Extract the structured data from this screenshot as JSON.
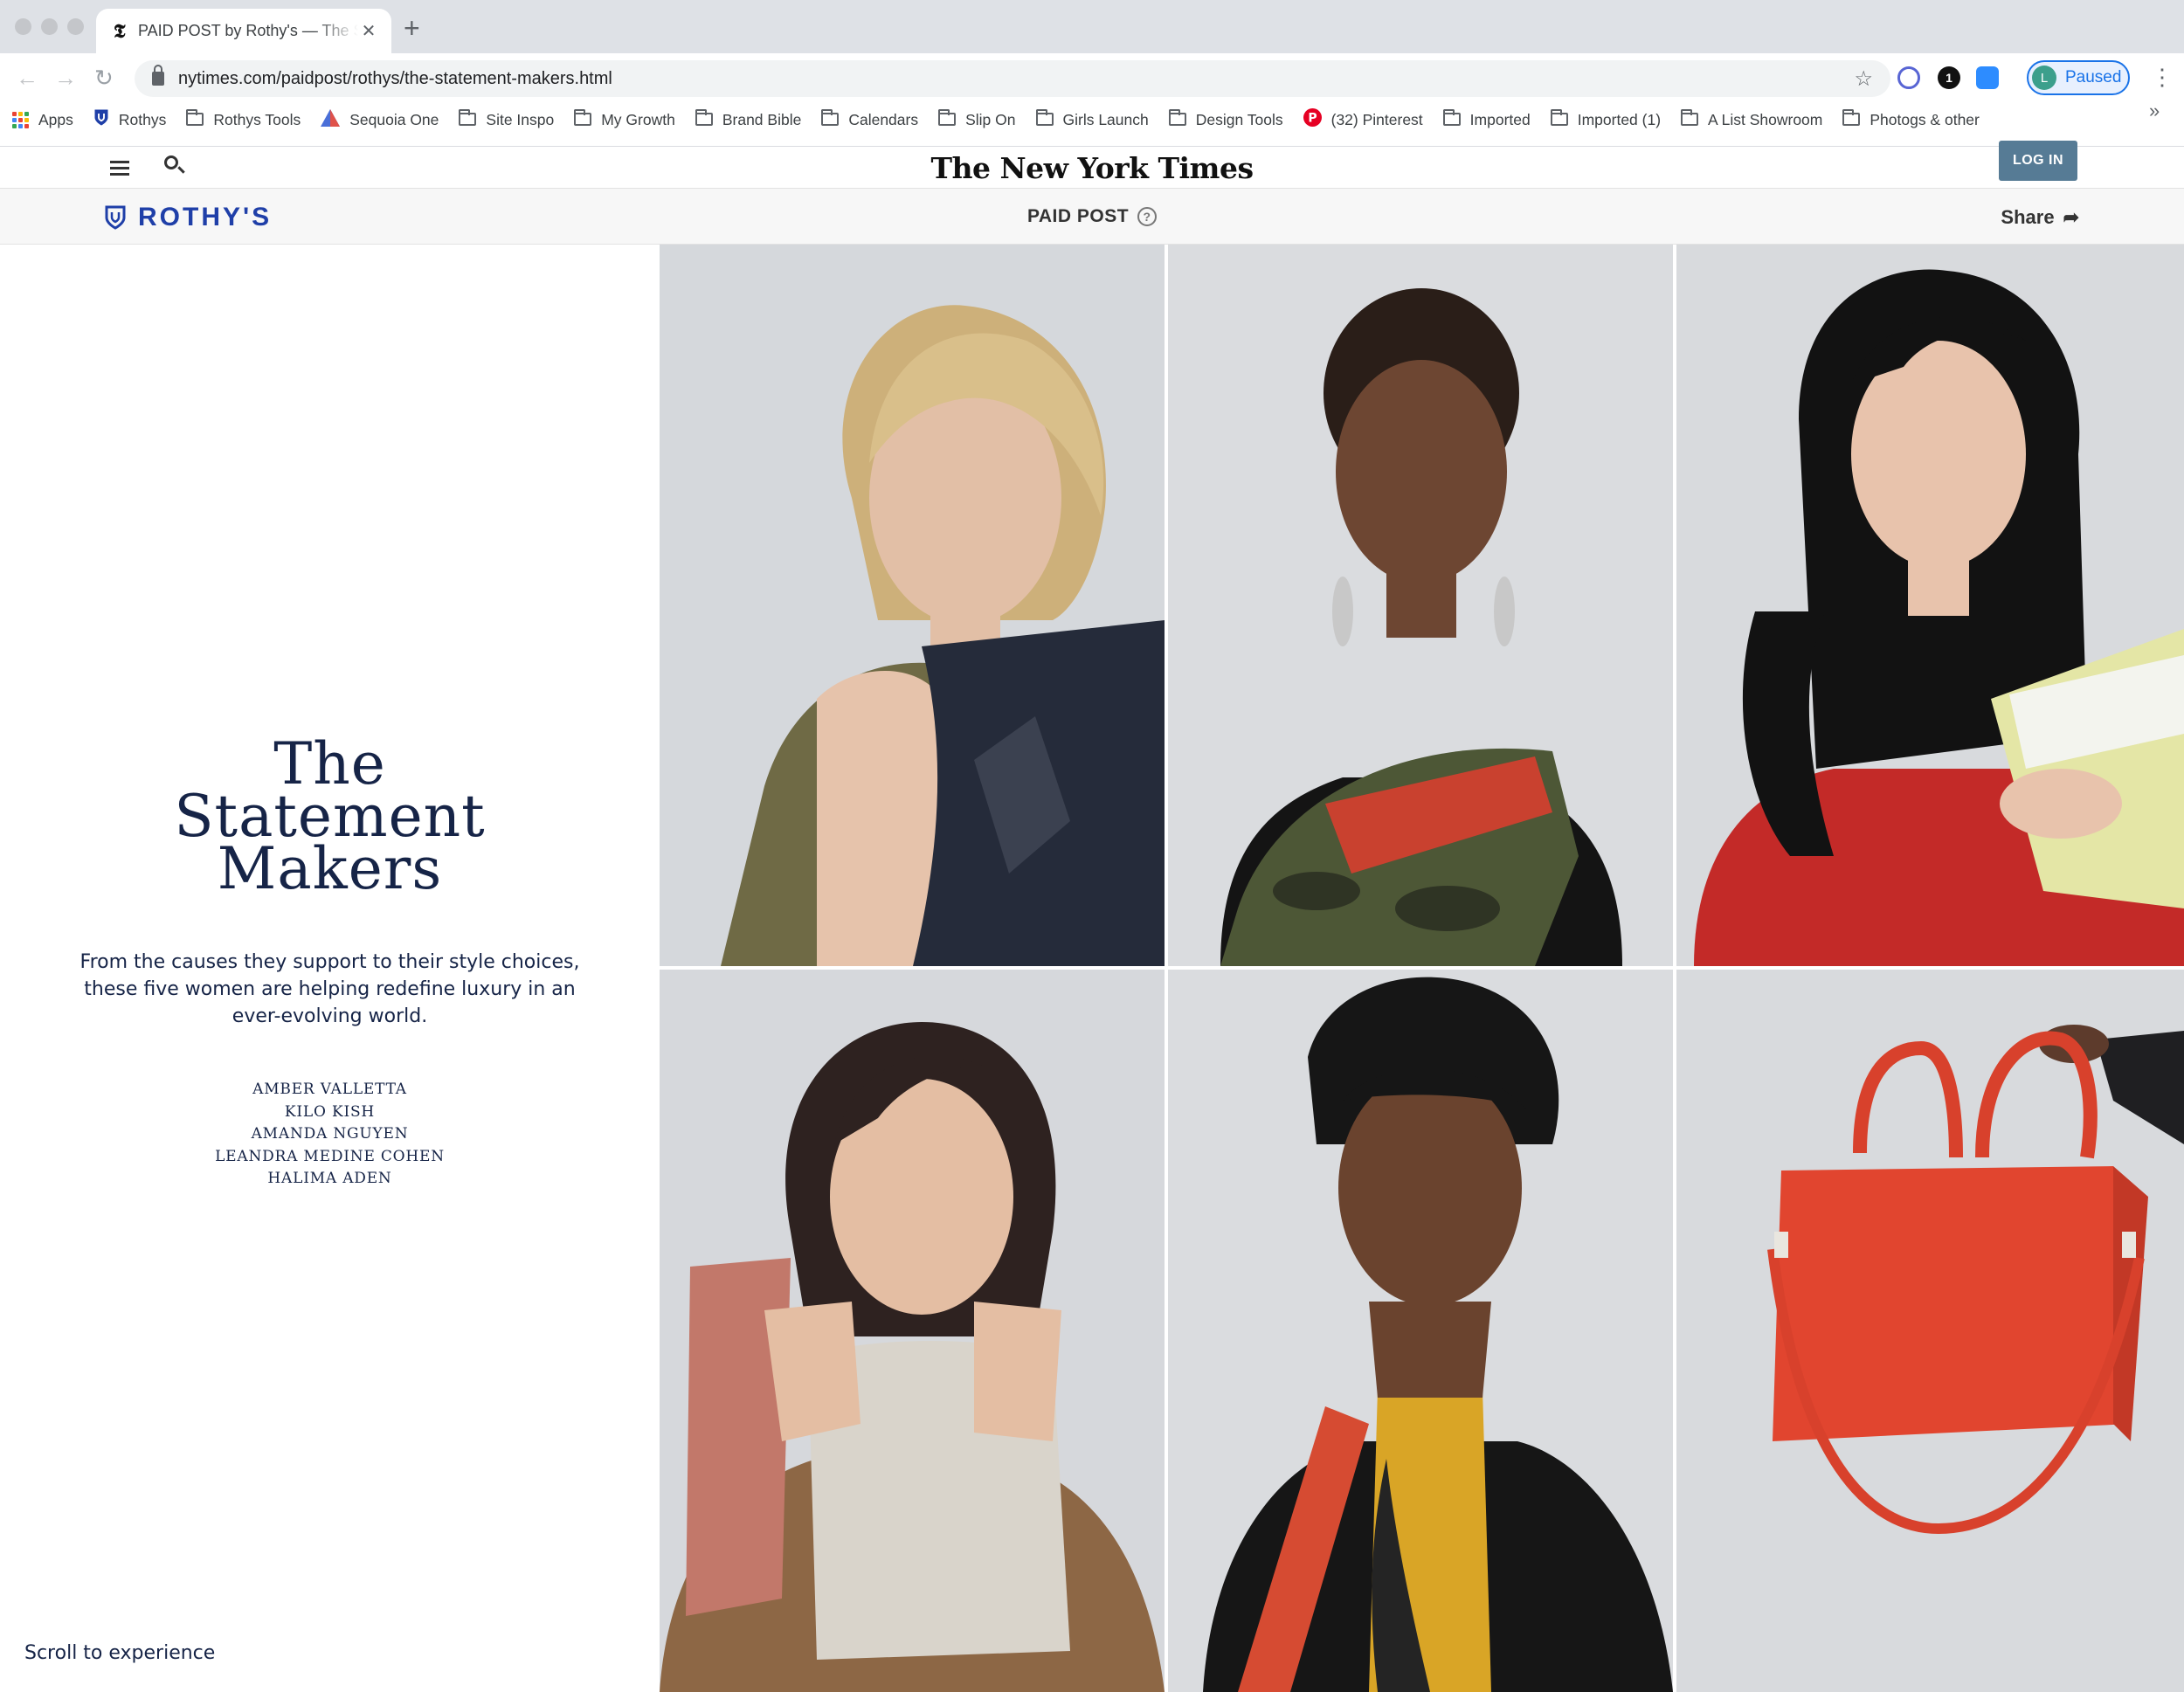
{
  "browser": {
    "tab_title": "PAID POST by Rothy's — The Statement Makers",
    "tab_favicon": "nyt-t-icon",
    "url": "nytimes.com/paidpost/rothys/the-statement-makers.html",
    "profile_initial": "L",
    "profile_status": "Paused",
    "bookmarks": [
      {
        "label": "Apps",
        "icon": "apps-grid-icon"
      },
      {
        "label": "Rothys",
        "icon": "rothys-shield-icon"
      },
      {
        "label": "Rothys Tools",
        "icon": "folder-icon"
      },
      {
        "label": "Sequoia One",
        "icon": "sequoia-icon"
      },
      {
        "label": "Site Inspo",
        "icon": "folder-icon"
      },
      {
        "label": "My Growth",
        "icon": "folder-icon"
      },
      {
        "label": "Brand Bible",
        "icon": "folder-icon"
      },
      {
        "label": "Calendars",
        "icon": "folder-icon"
      },
      {
        "label": "Slip On",
        "icon": "folder-icon"
      },
      {
        "label": "Girls Launch",
        "icon": "folder-icon"
      },
      {
        "label": "Design Tools",
        "icon": "folder-icon"
      },
      {
        "label": "(32) Pinterest",
        "icon": "pinterest-icon"
      },
      {
        "label": "Imported",
        "icon": "folder-icon"
      },
      {
        "label": "Imported (1)",
        "icon": "folder-icon"
      },
      {
        "label": "A List Showroom",
        "icon": "folder-icon"
      },
      {
        "label": "Photogs & other",
        "icon": "folder-icon"
      }
    ],
    "bookmarks_overflow": "»"
  },
  "nyt_header": {
    "masthead": "The New York Times",
    "login_label": "LOG IN"
  },
  "paid_bar": {
    "brand": "ROTHY'S",
    "label": "PAID POST",
    "help": "?",
    "share_label": "Share"
  },
  "intro": {
    "title_lines": [
      "The",
      "Statement",
      "Makers"
    ],
    "dek": "From the causes they support to their style choices, these five women are helping redefine luxury in an ever-evolving world.",
    "names": [
      "AMBER VALLETTA",
      "KILO KISH",
      "AMANDA NGUYEN",
      "LEANDRA MEDINE COHEN",
      "HALIMA ADEN"
    ],
    "scroll_cta": "Scroll to experience"
  },
  "colors": {
    "navy": "#162447",
    "rothys_blue": "#1f3fa8",
    "login_bg": "#567b95",
    "photo_bg": "#d8dbe0"
  }
}
